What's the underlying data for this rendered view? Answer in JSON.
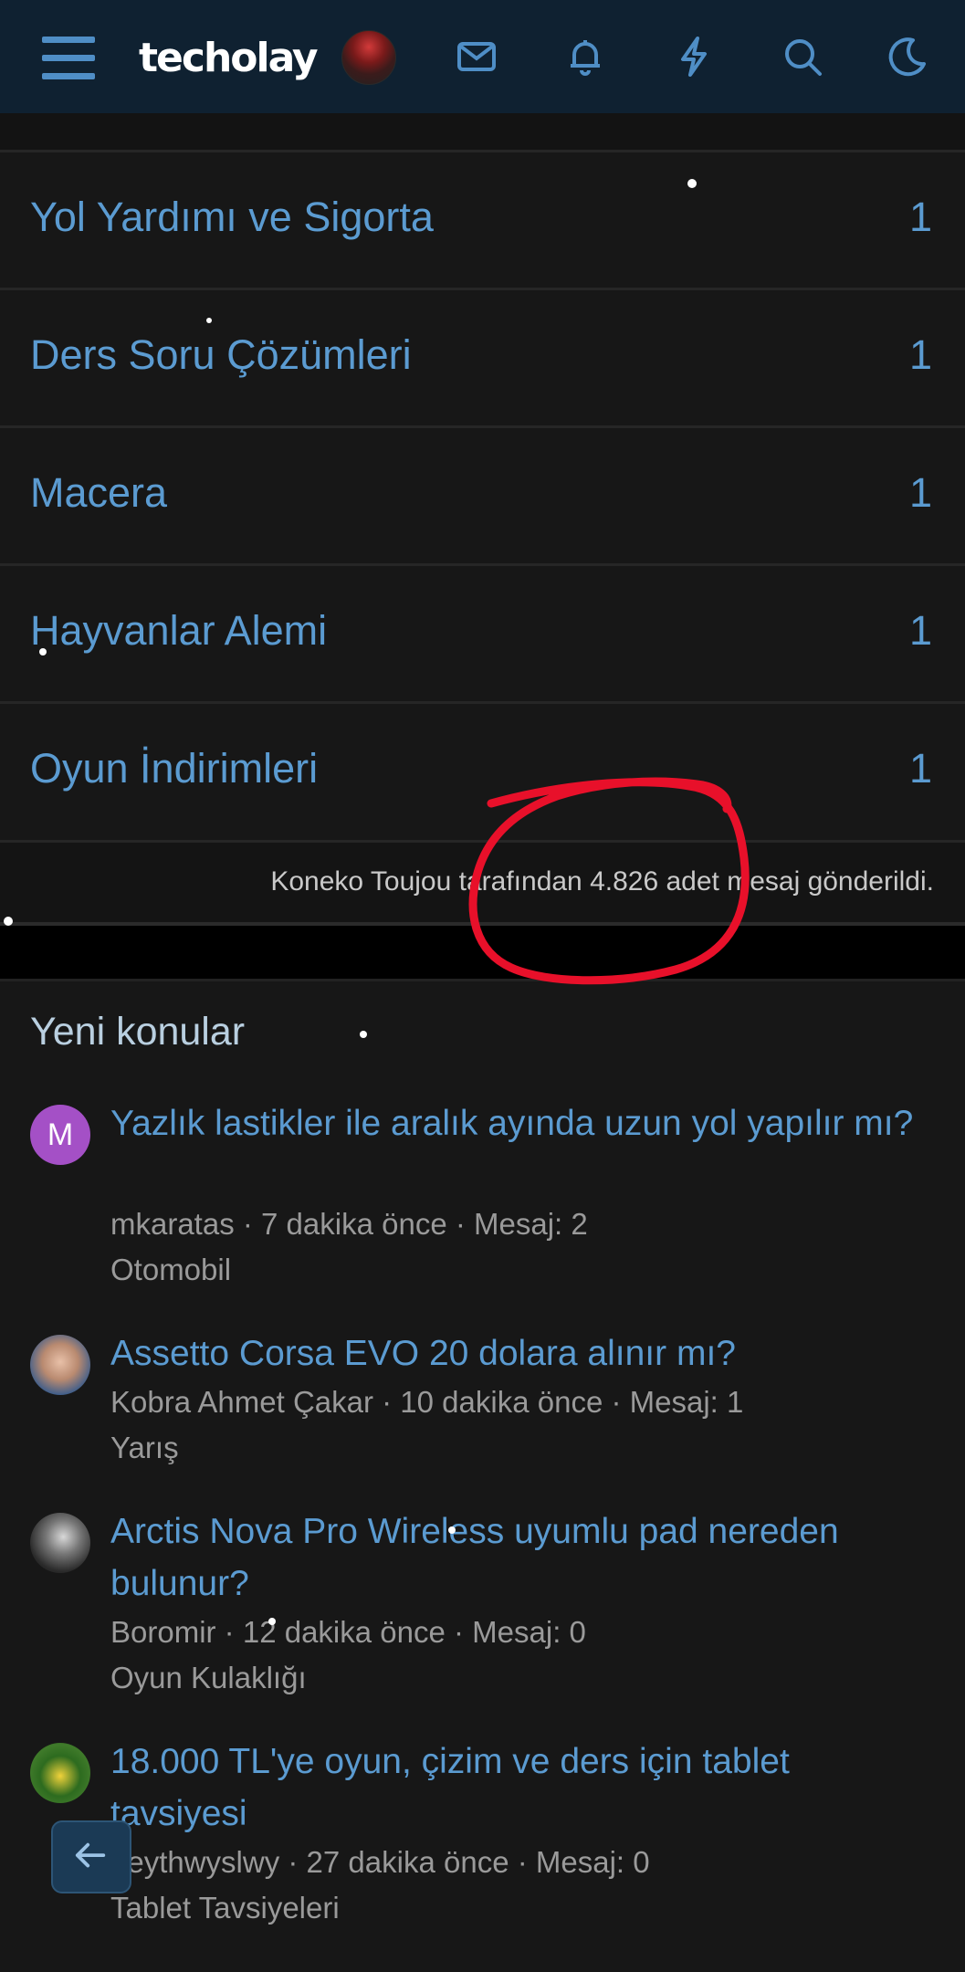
{
  "header": {
    "logo": "techolay",
    "menu_icon": "hamburger-icon",
    "icons": [
      "mail-icon",
      "bell-icon",
      "bolt-icon",
      "search-icon",
      "moon-icon"
    ]
  },
  "forums": [
    {
      "name": "Yol Yardımı ve Sigorta",
      "count": "1"
    },
    {
      "name": "Ders Soru Çözümleri",
      "count": "1"
    },
    {
      "name": "Macera",
      "count": "1"
    },
    {
      "name": "Hayvanlar Alemi",
      "count": "1"
    },
    {
      "name": "Oyun İndirimleri",
      "count": "1"
    }
  ],
  "footer_note": "Koneko Toujou tarafından 4.826 adet mesaj gönderildi.",
  "new_threads": {
    "title": "Yeni konular",
    "items": [
      {
        "avatar_letter": "M",
        "title": "Yazlık lastikler ile aralık ayında uzun yol yapılır mı?",
        "meta": "mkaratas · 7 dakika önce · Mesaj: 2",
        "forum": "Otomobil"
      },
      {
        "avatar_letter": "",
        "title": "Assetto Corsa EVO 20 dolara alınır mı?",
        "meta": "Kobra Ahmet Çakar · 10 dakika önce · Mesaj: 1",
        "forum": "Yarış"
      },
      {
        "avatar_letter": "",
        "title": "Arctis Nova Pro Wireless uyumlu pad nereden bulunur?",
        "meta": "Boromir · 12 dakika önce · Mesaj: 0",
        "forum": "Oyun Kulaklığı"
      },
      {
        "avatar_letter": "",
        "title": "18.000 TL'ye oyun, çizim ve ders için tablet tavsiyesi",
        "meta": "heythwyslwy · 27 dakika önce · Mesaj: 0",
        "forum": "Tablet Tavsiyeleri"
      }
    ]
  },
  "colors": {
    "header_bg": "#0f2131",
    "link": "#5b9bd1",
    "annotation": "#e8102a"
  },
  "back_button_icon": "arrow-left-icon"
}
